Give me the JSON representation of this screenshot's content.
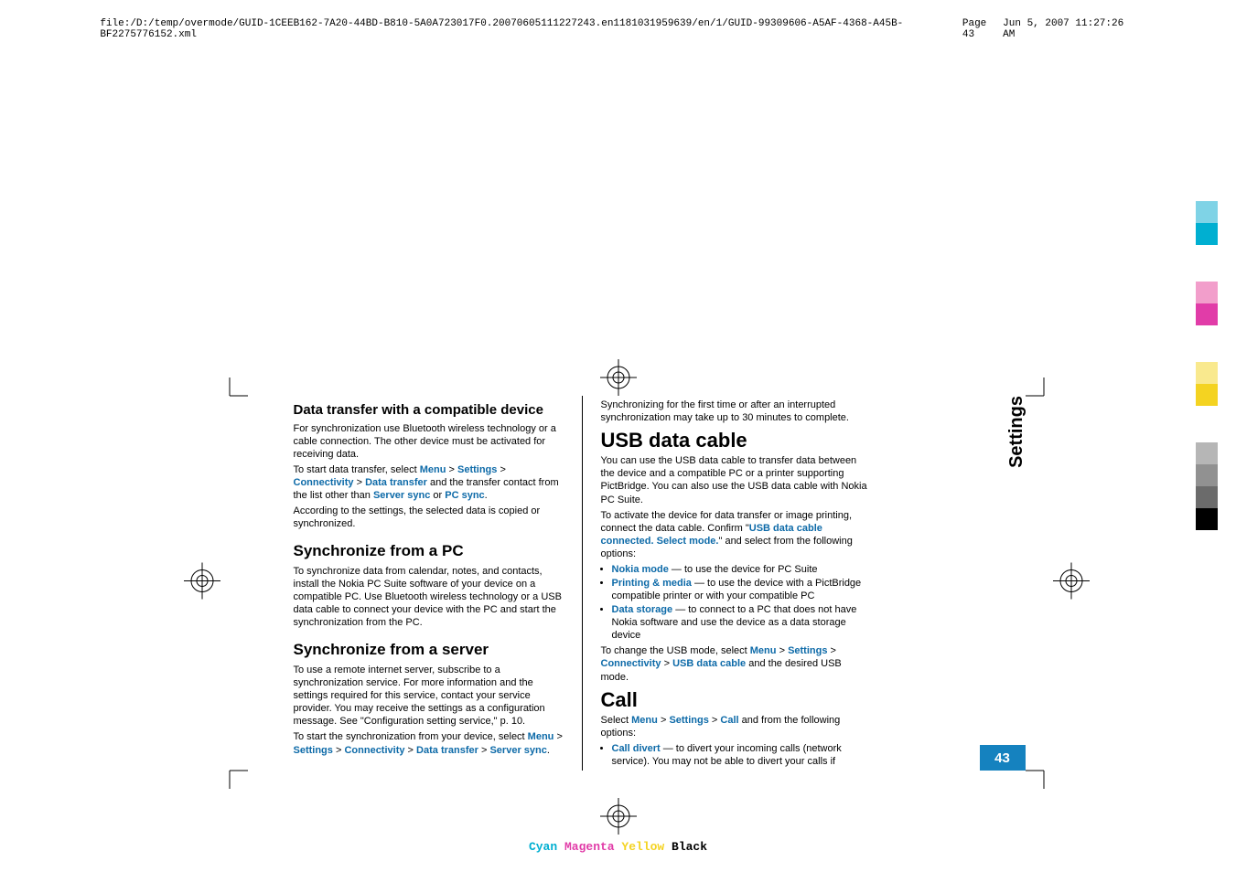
{
  "header": {
    "left": "file:/D:/temp/overmode/GUID-1CEEB162-7A20-44BD-B810-5A0A723017F0.20070605111227243.en1181031959639/en/1/GUID-99309606-A5AF-4368-A45B-BF2275776152.xml",
    "mid": "Page 43",
    "right": "Jun 5, 2007 11:27:26 AM"
  },
  "left_col": {
    "h3a": "Data transfer with a compatible device",
    "p1": "For synchronization use Bluetooth wireless technology or a cable connection. The other device must be activated for receiving data.",
    "p2a": "To start data transfer, select ",
    "p2_menu": "Menu",
    "gt": ">",
    "p2_settings": "Settings",
    "p2_conn": "Connectivity",
    "p2_dt": "Data transfer",
    "p2b": " and the transfer contact from the list other than ",
    "p2_ss": "Server sync",
    "p2_or": " or ",
    "p2_pc": "PC sync",
    "p2_end": ".",
    "p3": "According to the settings, the selected data is copied or synchronized.",
    "h2a": "Synchronize from a PC",
    "p4": "To synchronize data from calendar, notes, and contacts, install the Nokia PC Suite software of your device on a compatible PC. Use Bluetooth wireless technology or a USB data cable to connect your device with the PC and start the synchronization from the PC.",
    "h2b": "Synchronize from a server",
    "p5": "To use a remote internet server, subscribe to a synchronization service. For more information and the settings required for this service, contact your service provider. You may receive the settings as a configuration message. See \"Configuration setting service,\" p. 10.",
    "p6a": "To start the synchronization from your device, select ",
    "p6_menu": "Menu",
    "p6_settings": "Settings",
    "p6_conn": "Connectivity",
    "p6_dt": "Data transfer",
    "p6_ss": "Server sync",
    "p6_end": "."
  },
  "right_col": {
    "p1": "Synchronizing for the first time or after an interrupted synchronization may take up to 30 minutes to complete.",
    "h1a": "USB data cable",
    "p2": "You can use the USB data cable to transfer data between the device and a compatible PC or a printer supporting PictBridge. You can also use the USB data cable with Nokia PC Suite.",
    "p3a": "To activate the device for data transfer or image printing, connect the data cable. Confirm \"",
    "p3_conf": "USB data cable connected. Select mode.",
    "p3b": "\" and select from the following options:",
    "li1a": "Nokia mode",
    "li1b": " — to use the device for PC Suite",
    "li2a": "Printing & media",
    "li2b": " — to use the device with a PictBridge compatible printer or with your compatible PC",
    "li3a": "Data storage",
    "li3b": " — to connect to a PC that does not have Nokia software and use the device as a data storage device",
    "p4a": "To change the USB mode, select ",
    "p4_menu": "Menu",
    "p4_settings": "Settings",
    "p4_conn": "Connectivity",
    "p4_usb": "USB data cable",
    "p4b": " and the desired USB mode.",
    "h1b": "Call",
    "p5a": "Select ",
    "p5_menu": "Menu",
    "p5_settings": "Settings",
    "p5_call": "Call",
    "p5b": " and from the following options:",
    "li4a": "Call divert",
    "li4b": " — to divert your incoming calls (network service). You may not be able to divert your calls if"
  },
  "side_tab": "Settings",
  "page_number": "43",
  "footer": {
    "c": "Cyan",
    "m": "Magenta",
    "y": "Yellow",
    "k": "Black"
  }
}
